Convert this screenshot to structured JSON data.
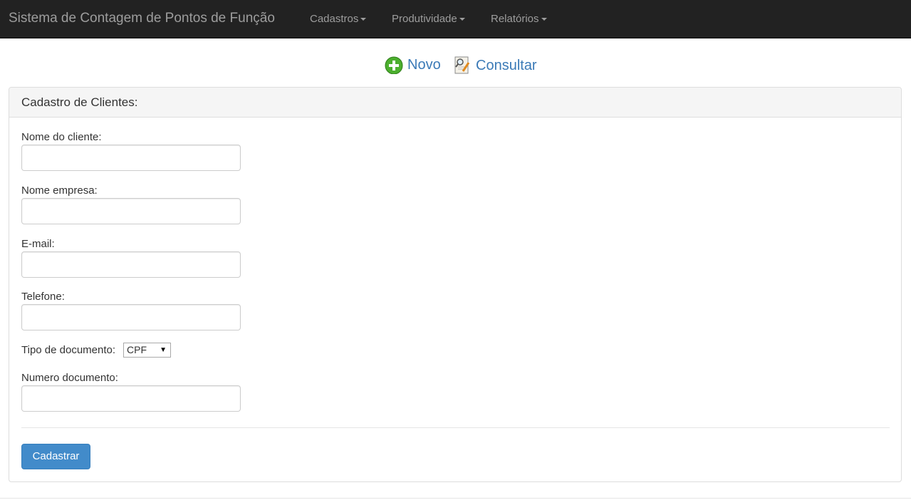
{
  "navbar": {
    "brand": "Sistema de Contagem de Pontos de Função",
    "items": [
      {
        "label": "Cadastros"
      },
      {
        "label": "Produtividade"
      },
      {
        "label": "Relatórios"
      }
    ]
  },
  "actions": {
    "new_label": "Novo",
    "search_label": "Consultar"
  },
  "panel": {
    "title": "Cadastro de Clientes:"
  },
  "form": {
    "client_name_label": "Nome do cliente:",
    "company_name_label": "Nome empresa:",
    "email_label": "E-mail:",
    "phone_label": "Telefone:",
    "doc_type_label": "Tipo de documento:",
    "doc_type_selected": "CPF",
    "doc_number_label": "Numero documento:",
    "submit_label": "Cadastrar"
  },
  "colors": {
    "navbar_bg": "#222222",
    "link": "#3b7ab7",
    "primary_button": "#428bca"
  }
}
